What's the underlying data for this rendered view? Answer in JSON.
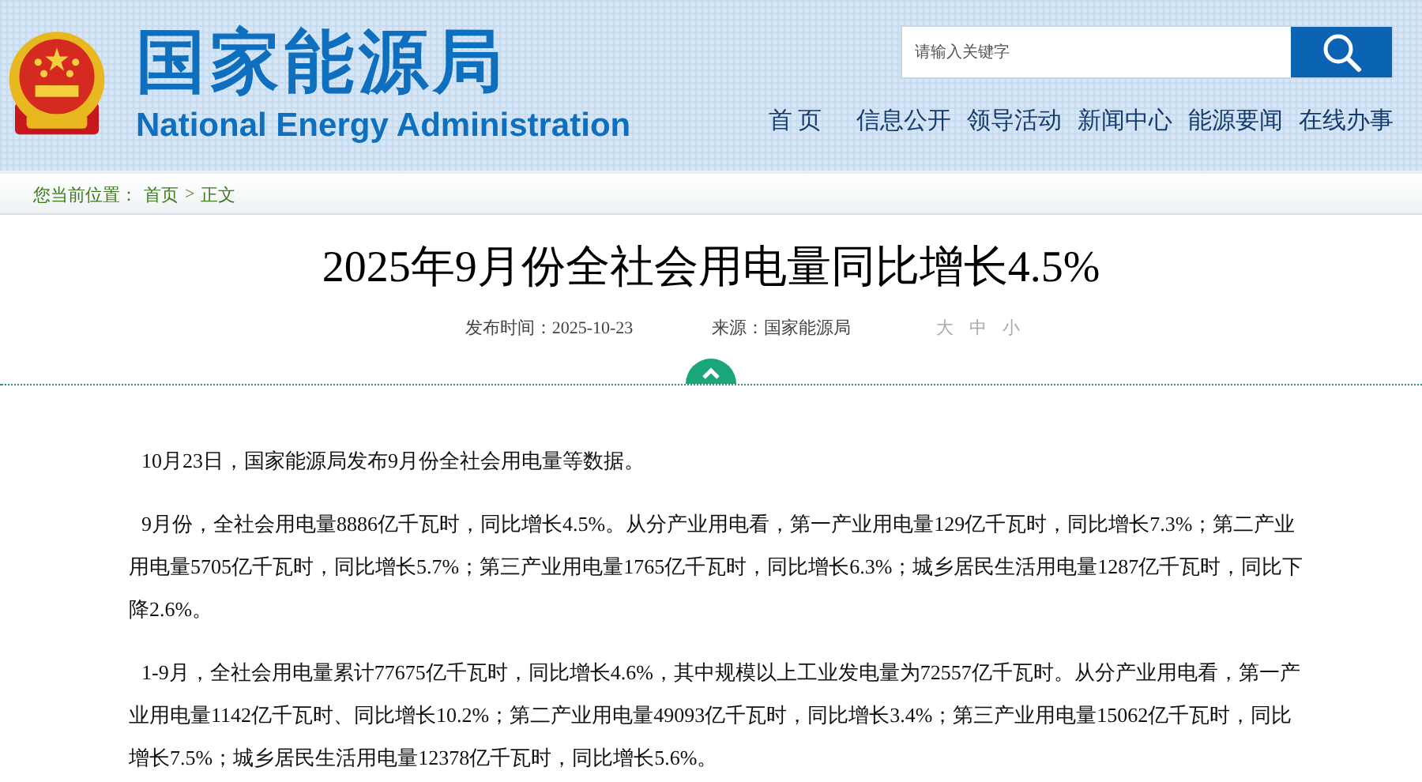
{
  "header": {
    "title_cn": "国家能源局",
    "title_en": "National Energy Administration",
    "search": {
      "placeholder": "请输入关键字"
    },
    "nav": [
      {
        "label": "首 页"
      },
      {
        "label": "信息公开"
      },
      {
        "label": "领导活动"
      },
      {
        "label": "新闻中心"
      },
      {
        "label": "能源要闻"
      },
      {
        "label": "在线办事"
      }
    ]
  },
  "breadcrumb": {
    "label": "您当前位置：",
    "separator": ">",
    "links": [
      "首页",
      "正文"
    ]
  },
  "article": {
    "title": "2025年9月份全社会用电量同比增长4.5%",
    "meta": [
      {
        "label": "发布时间：",
        "value": "2025-10-23"
      },
      {
        "label": "来源：",
        "value": "国家能源局"
      }
    ],
    "font_sizes": [
      "大",
      "中",
      "小"
    ],
    "paragraphs": [
      "10月23日，国家能源局发布9月份全社会用电量等数据。",
      "9月份，全社会用电量8886亿千瓦时，同比增长4.5%。从分产业用电看，第一产业用电量129亿千瓦时，同比增长7.3%；第二产业用电量5705亿千瓦时，同比增长5.7%；第三产业用电量1765亿千瓦时，同比增长6.3%；城乡居民生活用电量1287亿千瓦时，同比下降2.6%。",
      "1-9月，全社会用电量累计77675亿千瓦时，同比增长4.6%，其中规模以上工业发电量为72557亿千瓦时。从分产业用电看，第一产业用电量1142亿千瓦时、同比增长10.2%；第二产业用电量49093亿千瓦时，同比增长3.4%；第三产业用电量15062亿千瓦时，同比增长7.5%；城乡居民生活用电量12378亿千瓦时，同比增长5.6%。"
    ]
  }
}
